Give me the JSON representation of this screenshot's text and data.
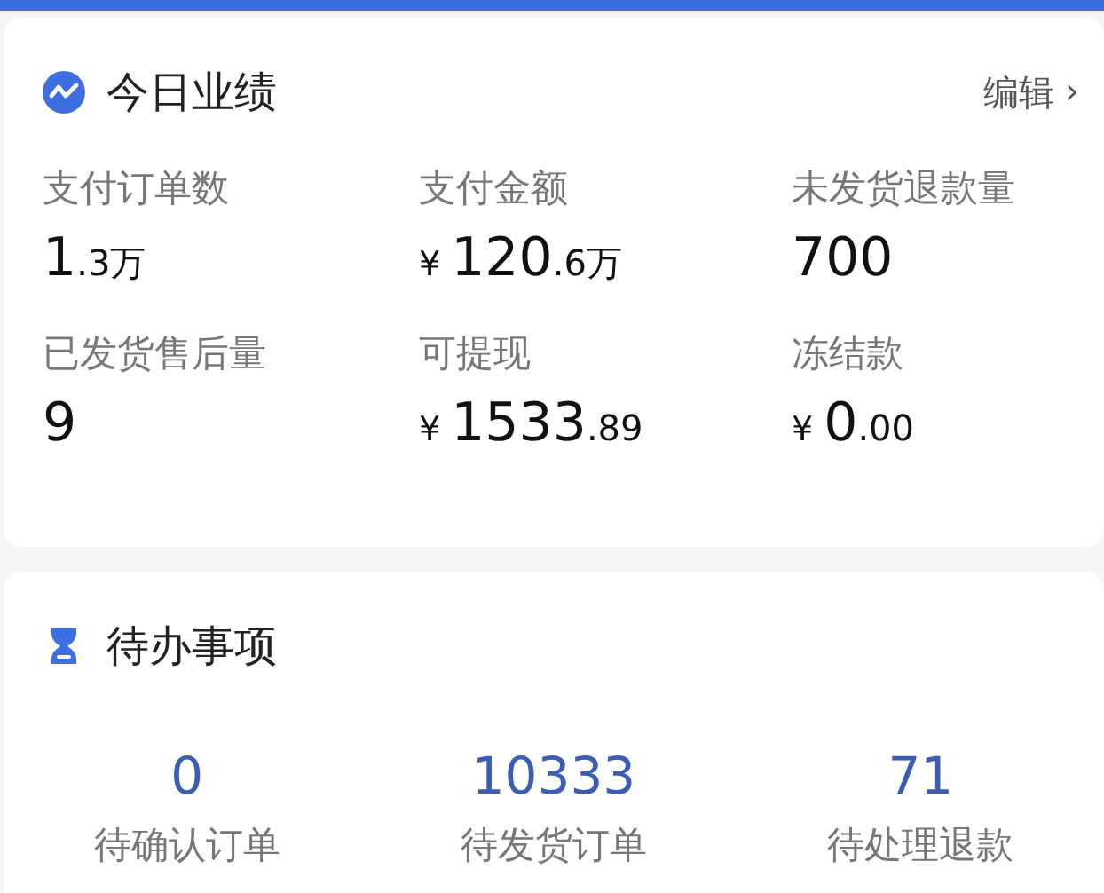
{
  "performance": {
    "title": "今日业绩",
    "edit_link": "编辑",
    "edit_chevron": "›",
    "metrics": [
      {
        "label": "支付订单数",
        "value": "1",
        "small": ".3万"
      },
      {
        "label": "支付金额",
        "currency": "¥",
        "value": "120",
        "small": ".6万"
      },
      {
        "label": "未发货退款量",
        "value": "700"
      },
      {
        "label": "已发货售后量",
        "value": "9"
      },
      {
        "label": "可提现",
        "currency": "¥",
        "value": "1533",
        "small": ".89"
      },
      {
        "label": "冻结款",
        "currency": "¥",
        "value": "0",
        "small": ".00"
      }
    ]
  },
  "todo": {
    "title": "待办事项",
    "items": [
      {
        "count": "0",
        "label": "待确认订单"
      },
      {
        "count": "10333",
        "label": "待发货订单"
      },
      {
        "count": "71",
        "label": "待处理退款"
      }
    ]
  }
}
